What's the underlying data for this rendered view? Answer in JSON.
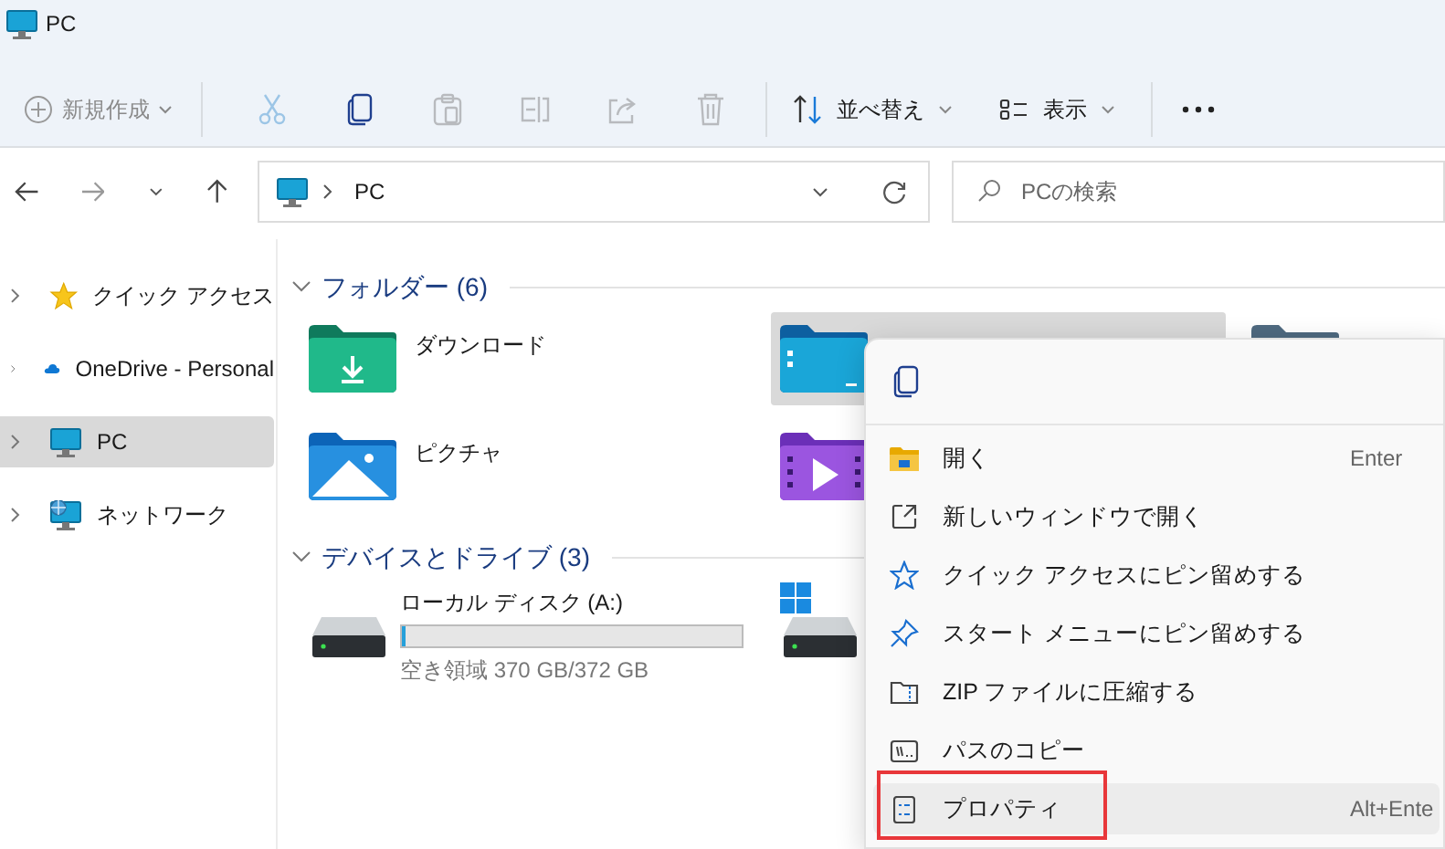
{
  "window": {
    "title": "PC"
  },
  "toolbar": {
    "new": {
      "label": "新規作成",
      "disabled": true
    },
    "actions": [
      {
        "kind": "cut",
        "disabled": true
      },
      {
        "kind": "copy",
        "disabled": false
      },
      {
        "kind": "paste",
        "disabled": true
      },
      {
        "kind": "rename",
        "disabled": true
      },
      {
        "kind": "share",
        "disabled": true
      },
      {
        "kind": "delete",
        "disabled": true
      }
    ],
    "sort": {
      "label": "並べ替え"
    },
    "view": {
      "label": "表示"
    }
  },
  "address": {
    "path": "PC"
  },
  "search": {
    "placeholder": "PCの検索"
  },
  "sidebar": {
    "items": [
      {
        "kind": "star",
        "label": "クイック アクセス",
        "selected": false
      },
      {
        "kind": "cloud",
        "label": "OneDrive - Personal",
        "selected": false
      },
      {
        "kind": "pc",
        "label": "PC",
        "selected": true
      },
      {
        "kind": "network",
        "label": "ネットワーク",
        "selected": false
      }
    ]
  },
  "sections": [
    {
      "title": "フォルダー (6)",
      "kind": "folders",
      "items": [
        {
          "kind": "downloads",
          "label": "ダウンロード",
          "selected": false
        },
        {
          "kind": "desktop",
          "selected": true
        },
        {
          "kind": "documents",
          "selected": false
        },
        {
          "kind": "pictures",
          "label": "ピクチャ",
          "selected": false
        },
        {
          "kind": "videos",
          "selected": false
        }
      ]
    },
    {
      "title": "デバイスとドライブ (3)",
      "kind": "drives",
      "items": [
        {
          "kind": "hdd",
          "label": "ローカル ディスク (A:)",
          "level": 0.01,
          "free": "空き領域 370 GB/372 GB"
        },
        {
          "kind": "windows"
        }
      ]
    }
  ],
  "context_menu": {
    "top_actions": [
      {
        "kind": "copy"
      }
    ],
    "items": [
      {
        "kind": "open",
        "label": "開く",
        "shortcut": "Enter",
        "highlighted": false,
        "outlined": false
      },
      {
        "kind": "new-window",
        "label": "新しいウィンドウで開く",
        "highlighted": false,
        "outlined": false
      },
      {
        "kind": "star",
        "label": "クイック アクセスにピン留めする",
        "highlighted": false,
        "outlined": false
      },
      {
        "kind": "pin",
        "label": "スタート メニューにピン留めする",
        "highlighted": false,
        "outlined": false
      },
      {
        "kind": "zip",
        "label": "ZIP ファイルに圧縮する",
        "highlighted": false,
        "outlined": false
      },
      {
        "kind": "path",
        "label": "パスのコピー",
        "highlighted": false,
        "outlined": false
      },
      {
        "kind": "properties",
        "label": "プロパティ",
        "shortcut": "Alt+Ente",
        "highlighted": true,
        "outlined": true
      }
    ]
  }
}
